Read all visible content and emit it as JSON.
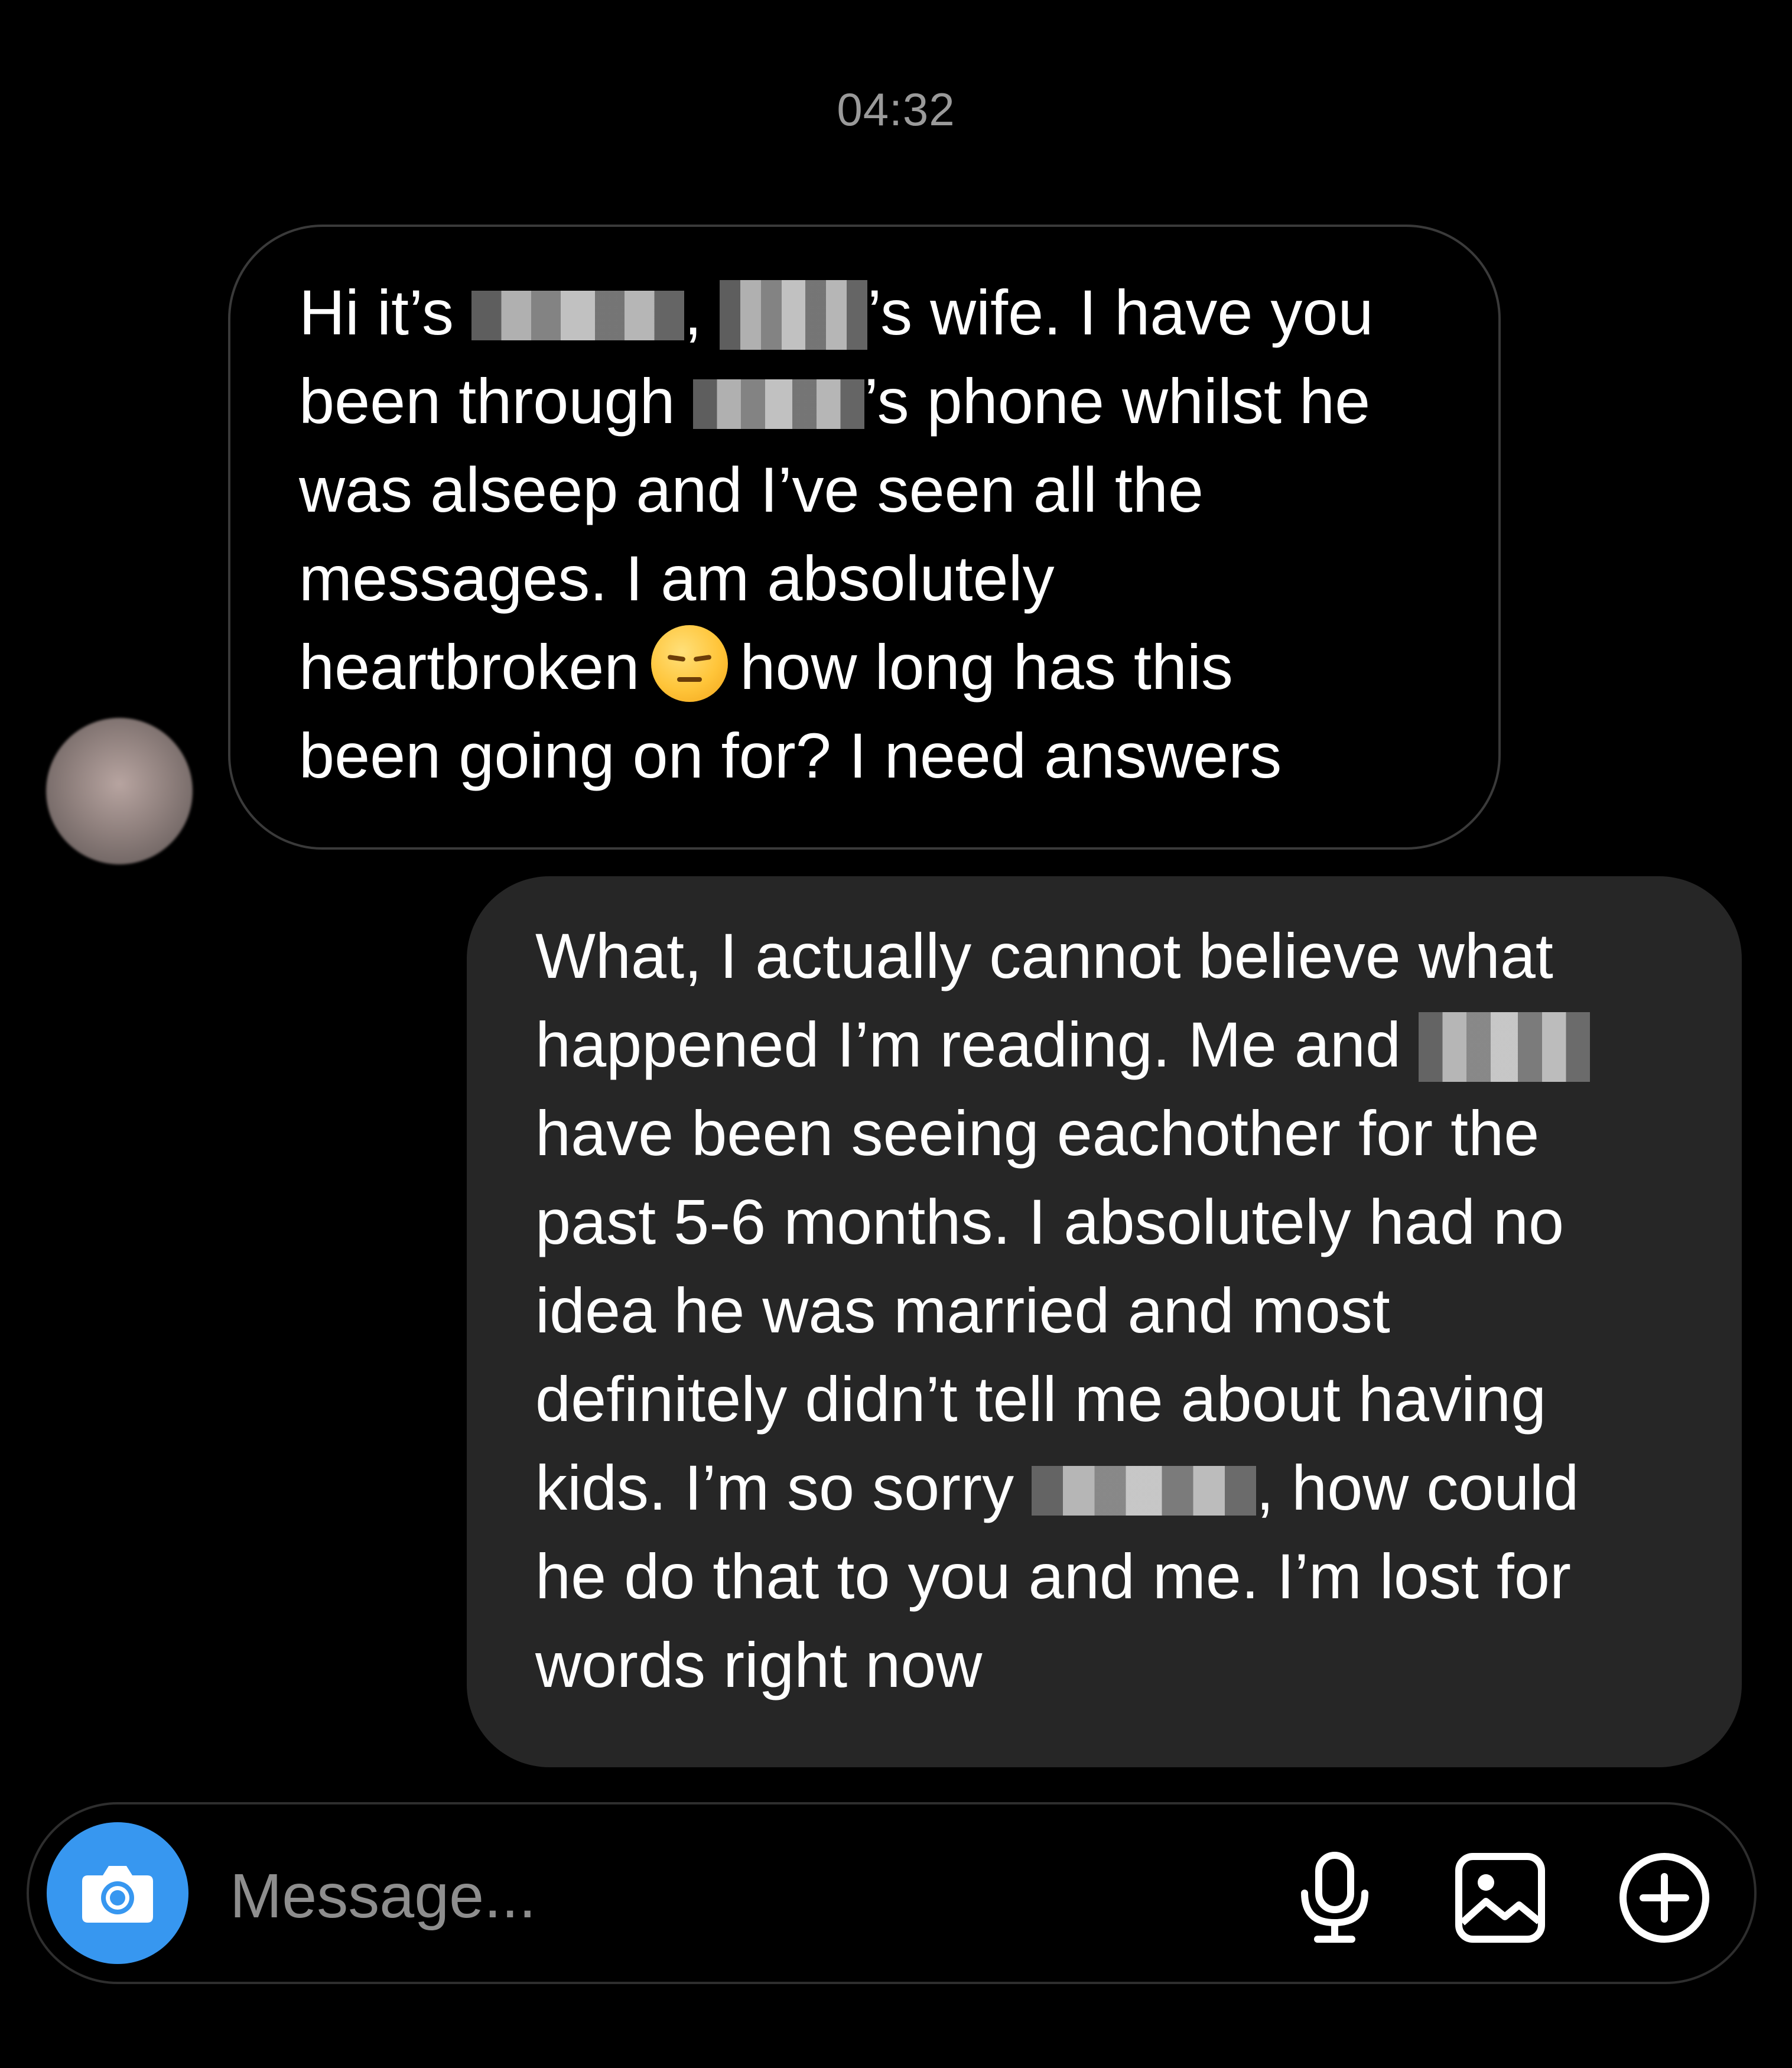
{
  "conversation": {
    "timestamp": "04:32",
    "incoming_message": {
      "lines": [
        {
          "before": "Hi it’s ",
          "after": ", ",
          "tail": "’s wife. I have you"
        },
        {
          "text_a": "been through ",
          "text_b": "’s phone whilst he"
        },
        {
          "text": "was alseep and I’ve seen all the"
        },
        {
          "text": "messages. I am absolutely"
        },
        {
          "a": "heartbroken",
          "b": "how long has this"
        },
        {
          "text": "been going on for? I need answers"
        }
      ],
      "emoji": "pensive-face-emoji"
    },
    "outgoing_message": {
      "lines": [
        {
          "text": "What, I actually cannot believe what"
        },
        {
          "text": "happened I’m reading. Me and "
        },
        {
          "text": "have been seeing eachother for the"
        },
        {
          "text": "past 5-6 months. I absolutely had no"
        },
        {
          "text": "idea he was married and most"
        },
        {
          "text": "definitely didn’t tell me about having"
        },
        {
          "before": "kids. I’m so sorry ",
          "after": ", how could"
        },
        {
          "text": "he do that to you and me. I’m lost for"
        },
        {
          "text": "words right now"
        }
      ]
    }
  },
  "composer": {
    "placeholder": "Message...",
    "value": "",
    "camera_icon": "camera-icon",
    "mic_icon": "microphone-icon",
    "gallery_icon": "image-gallery-icon",
    "add_icon": "plus-circle-icon",
    "accent_color": "#3797f0"
  },
  "colors": {
    "background": "#000000",
    "outgoing_bubble": "#262626",
    "incoming_border": "#3a3a3a",
    "timestamp": "#9a9a9a"
  }
}
